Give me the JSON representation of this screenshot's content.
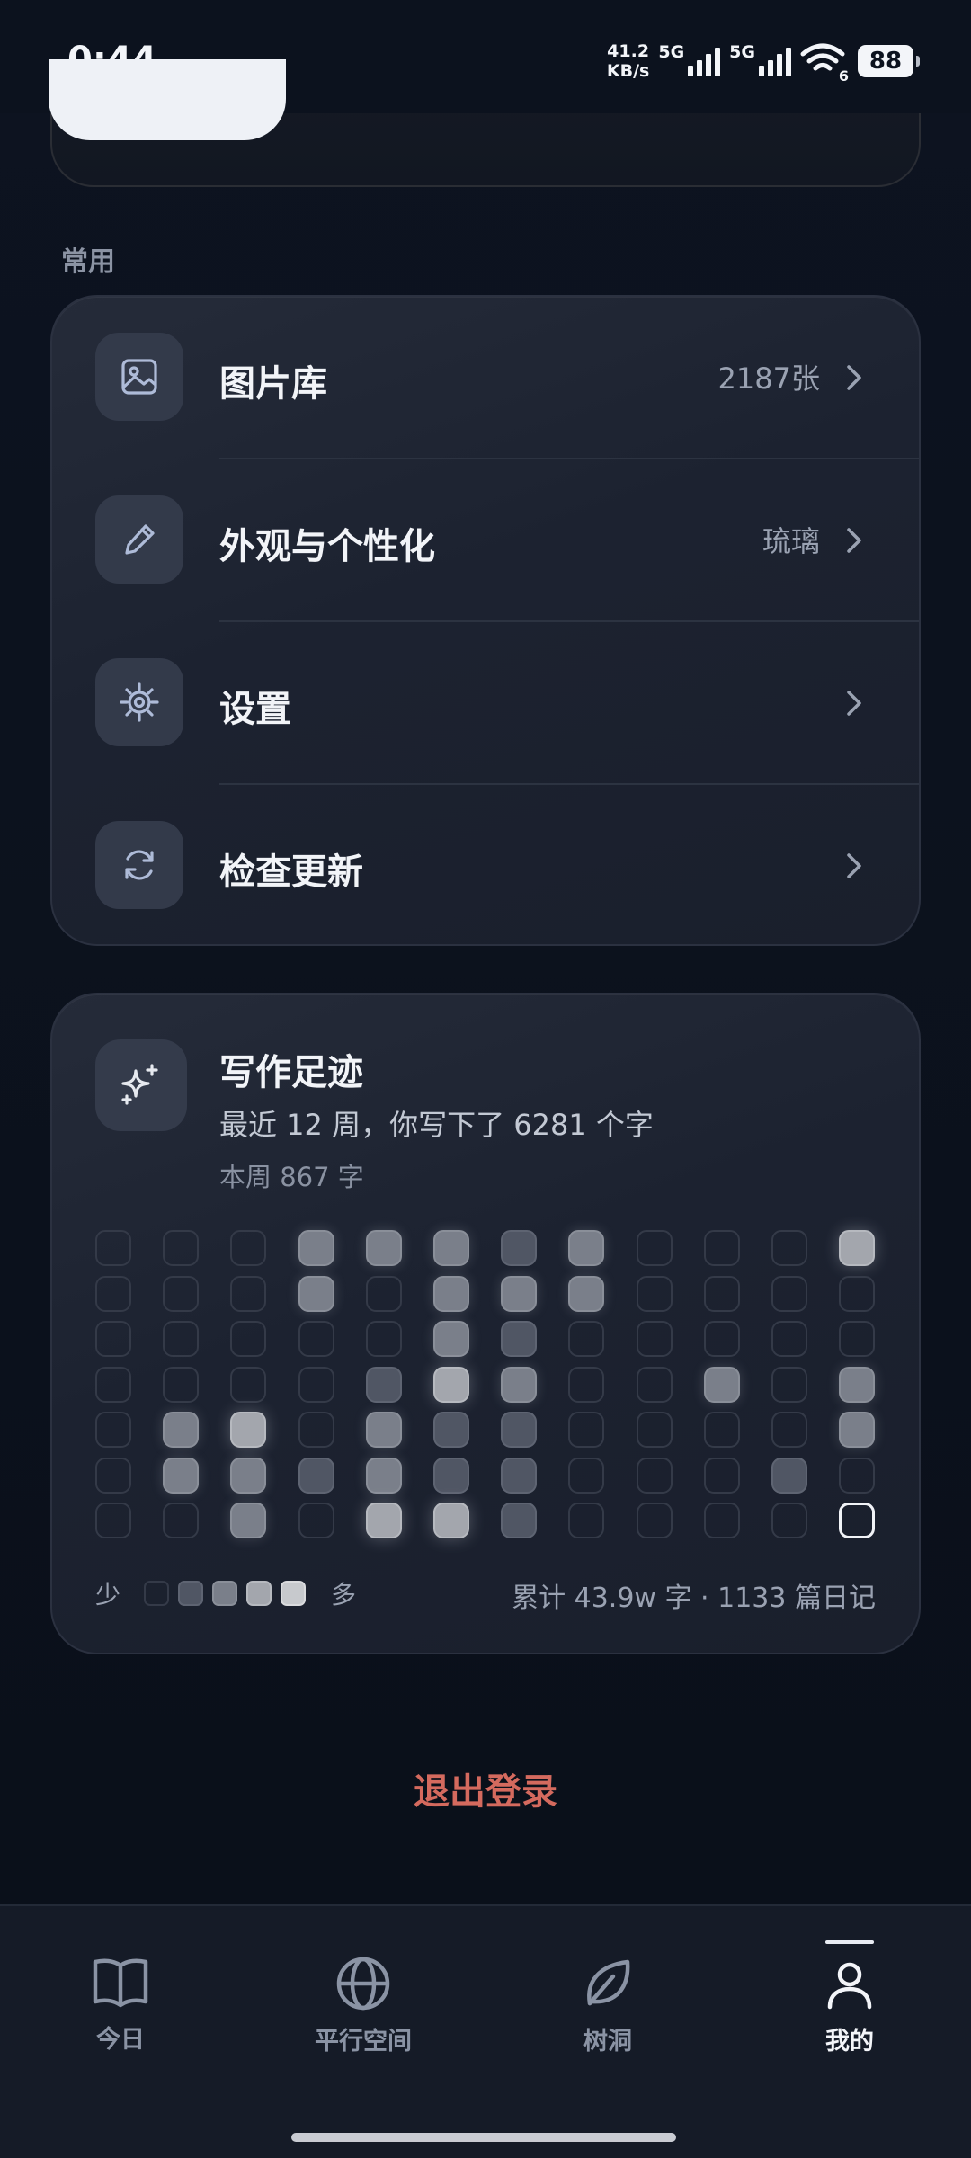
{
  "status_bar": {
    "time": "0:44",
    "speed_value": "41.2",
    "speed_unit": "KB/s",
    "sim1_label": "5G",
    "sim2_label": "5G",
    "wifi_label": "6",
    "battery": "88"
  },
  "section_label": "常用",
  "menu": [
    {
      "label": "图片库",
      "value": "2187张",
      "icon": "image-icon"
    },
    {
      "label": "外观与个性化",
      "value": "琉璃",
      "icon": "brush-icon"
    },
    {
      "label": "设置",
      "value": "",
      "icon": "gear-icon"
    },
    {
      "label": "检查更新",
      "value": "",
      "icon": "refresh-icon"
    }
  ],
  "writing": {
    "title": "写作足迹",
    "subtitle": "最近 12 周，你写下了 6281 个字",
    "this_week": "本周 867 字",
    "legend_less": "少",
    "legend_more": "多",
    "total": "累计 43.9w 字 · 1133 篇日记",
    "heatmap_levels": [
      [
        0,
        0,
        0,
        0,
        0,
        0,
        0
      ],
      [
        0,
        0,
        0,
        0,
        2,
        2,
        0
      ],
      [
        0,
        0,
        0,
        0,
        3,
        2,
        2
      ],
      [
        2,
        2,
        0,
        0,
        0,
        1,
        0
      ],
      [
        2,
        0,
        0,
        1,
        2,
        2,
        3
      ],
      [
        2,
        2,
        2,
        3,
        1,
        1,
        3
      ],
      [
        1,
        2,
        1,
        2,
        1,
        1,
        1
      ],
      [
        2,
        2,
        0,
        0,
        0,
        0,
        0
      ],
      [
        0,
        0,
        0,
        0,
        0,
        0,
        0
      ],
      [
        0,
        0,
        0,
        2,
        0,
        0,
        0
      ],
      [
        0,
        0,
        0,
        0,
        0,
        1,
        0
      ],
      [
        3,
        0,
        0,
        2,
        2,
        0,
        "today"
      ]
    ],
    "legend_colors": [
      "#343a48",
      "#505664",
      "#7a7f8a",
      "#a3a6ad",
      "#c7c9cd"
    ]
  },
  "logout_label": "退出登录",
  "nav": [
    {
      "label": "今日",
      "icon": "book-icon",
      "active": false
    },
    {
      "label": "平行空间",
      "icon": "globe-icon",
      "active": false
    },
    {
      "label": "树洞",
      "icon": "leaf-icon",
      "active": false
    },
    {
      "label": "我的",
      "icon": "user-icon",
      "active": true
    }
  ],
  "colors": {
    "accent_logout": "#d46a5e",
    "background": "#0c121e",
    "card": "#1e2432"
  }
}
